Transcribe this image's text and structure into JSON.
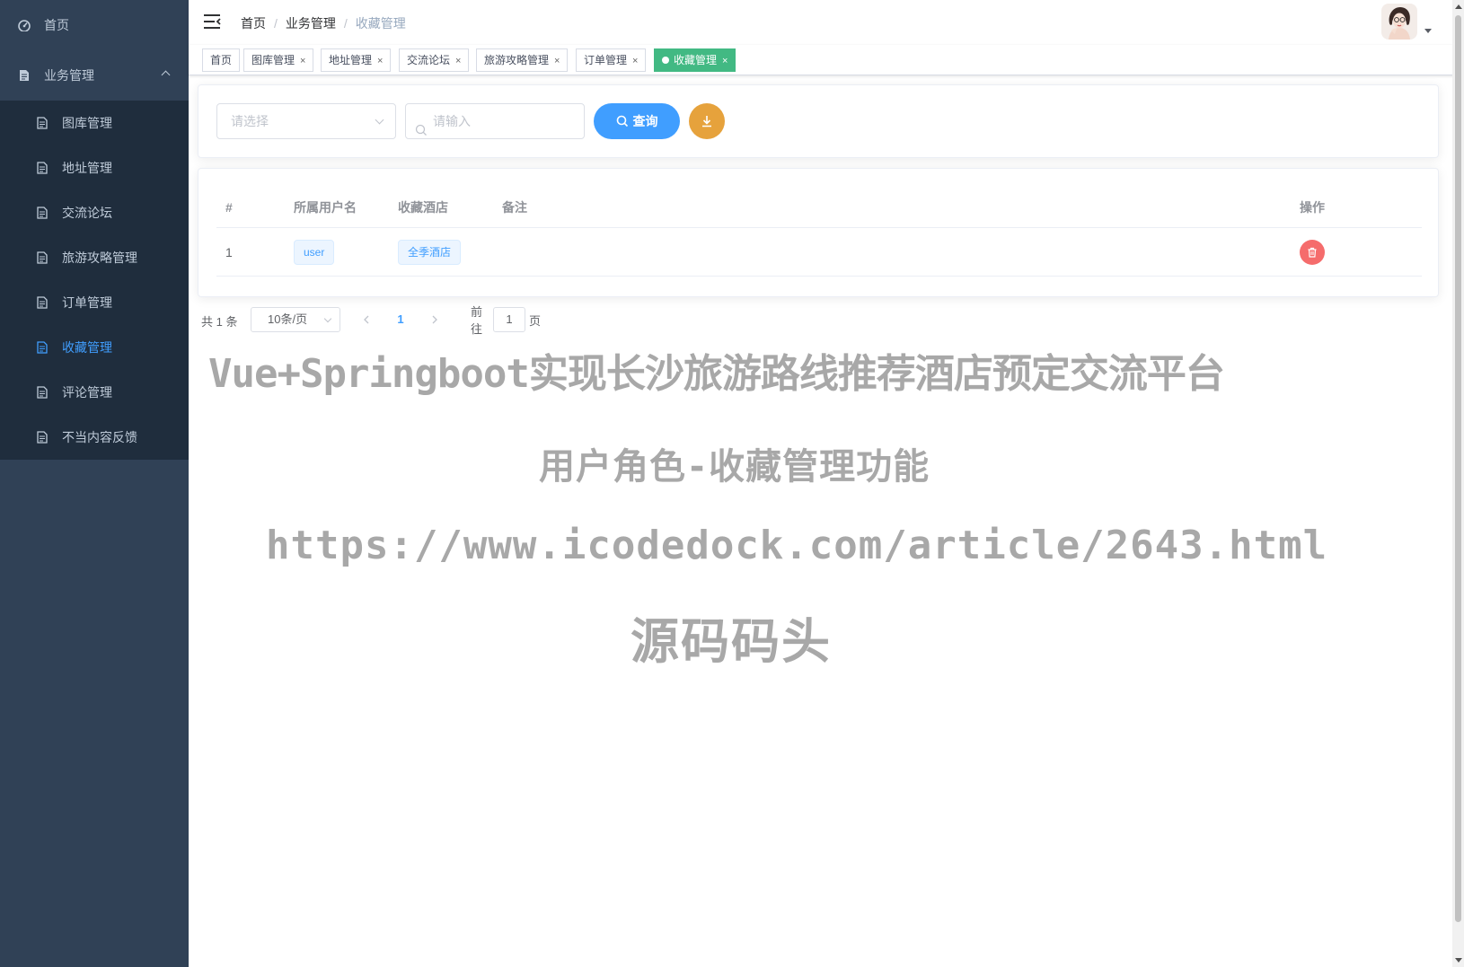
{
  "sidebar": {
    "home_label": "首页",
    "group_label": "业务管理",
    "items": [
      {
        "label": "图库管理",
        "active": false
      },
      {
        "label": "地址管理",
        "active": false
      },
      {
        "label": "交流论坛",
        "active": false
      },
      {
        "label": "旅游攻略管理",
        "active": false
      },
      {
        "label": "订单管理",
        "active": false
      },
      {
        "label": "收藏管理",
        "active": true
      },
      {
        "label": "评论管理",
        "active": false
      },
      {
        "label": "不当内容反馈",
        "active": false
      }
    ]
  },
  "breadcrumb": [
    "首页",
    "业务管理",
    "收藏管理"
  ],
  "tags": [
    {
      "label": "首页",
      "closable": false
    },
    {
      "label": "图库管理",
      "closable": true
    },
    {
      "label": "地址管理",
      "closable": true
    },
    {
      "label": "交流论坛",
      "closable": true
    },
    {
      "label": "旅游攻略管理",
      "closable": true
    },
    {
      "label": "订单管理",
      "closable": true
    },
    {
      "label": "收藏管理",
      "closable": true,
      "active": true
    }
  ],
  "tag_close_glyph": "×",
  "search": {
    "select_placeholder": "请选择",
    "input_placeholder": "请输入",
    "query_label": "查询"
  },
  "table": {
    "columns": [
      "#",
      "所属用户名",
      "收藏酒店",
      "备注",
      "操作"
    ],
    "rows": [
      {
        "index": "1",
        "username": "user",
        "hotel": "全季酒店",
        "remark": ""
      }
    ]
  },
  "pagination": {
    "total_text": "共 1 条",
    "page_size": "10条/页",
    "current_page": "1",
    "goto_label": "前往",
    "goto_value": "1",
    "page_suffix": "页"
  },
  "watermark": {
    "line1": "Vue+Springboot实现长沙旅游路线推荐酒店预定交流平台",
    "line2": "用户角色-收藏管理功能",
    "line3": "https://www.icodedock.com/article/2643.html",
    "line4": "源码码头"
  },
  "colors": {
    "sidebar_bg": "#304156",
    "submenu_bg": "#1f2d3d",
    "accent": "#409eff",
    "tag_active": "#42b983",
    "export_button": "#e6a23c",
    "delete_button": "#f56c6c"
  }
}
